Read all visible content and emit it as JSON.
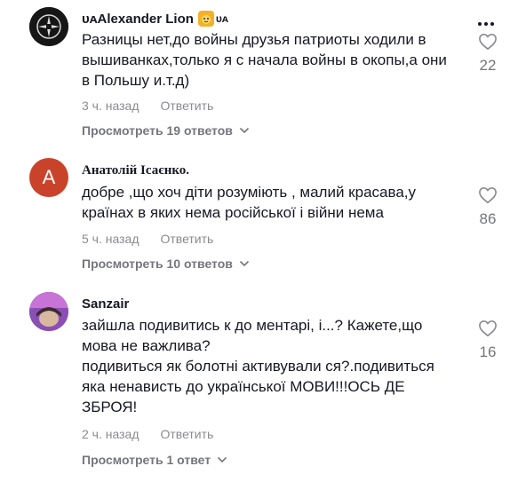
{
  "comments": [
    {
      "author": "ᴜᴀAlexander Lion",
      "author_suffix": "ᴜᴀ",
      "text_lines": [
        "Разницы нет,до войны друзья патриоты ходили в вышиванках,только я с начала войны в окопы,а они в Польшу и.т.д)"
      ],
      "time": "3 ч. назад",
      "reply_label": "Ответить",
      "view_replies": "Просмотреть 19 ответов",
      "likes": "22"
    },
    {
      "author": "Анатолій Ісаєнко.",
      "avatar_letter": "А",
      "text_lines": [
        "добре ,що хоч діти розуміють , малий красава,у країнах в яких нема російської і війни нема"
      ],
      "time": "5 ч. назад",
      "reply_label": "Ответить",
      "view_replies": "Просмотреть 10 ответов",
      "likes": "86"
    },
    {
      "author": "Sanzair",
      "text_lines": [
        "зайшла подивитись к до ментарі, і...? Кажете,що мова не важлива?",
        "подивиться як болотні активували ся?.подивиться яка ненависть до української МОВИ!!!ОСЬ ДЕ ЗБРОЯ!"
      ],
      "time": "2 ч. назад",
      "reply_label": "Ответить",
      "view_replies": "Просмотреть 1 ответ",
      "likes": "16"
    }
  ],
  "colors": {
    "text": "#161823",
    "meta": "#8a8b91",
    "avatar_letter_bg": "#c9432b"
  }
}
